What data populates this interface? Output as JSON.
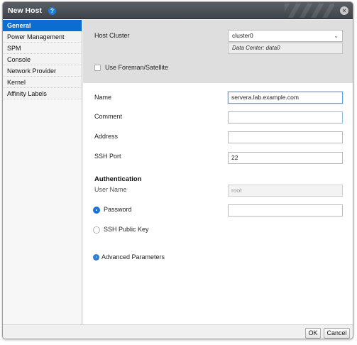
{
  "dialog": {
    "title": "New Host",
    "help_icon": "question-circle-icon",
    "close_icon": "close-icon"
  },
  "sidebar": {
    "items": [
      {
        "label": "General",
        "active": true
      },
      {
        "label": "Power Management",
        "active": false
      },
      {
        "label": "SPM",
        "active": false
      },
      {
        "label": "Console",
        "active": false
      },
      {
        "label": "Network Provider",
        "active": false
      },
      {
        "label": "Kernel",
        "active": false
      },
      {
        "label": "Affinity Labels",
        "active": false
      }
    ]
  },
  "general": {
    "host_cluster_label": "Host Cluster",
    "host_cluster_value": "cluster0",
    "data_center_text": "Data Center: data0",
    "use_foreman_label": "Use Foreman/Satellite",
    "name_label": "Name",
    "name_value": "servera.lab.example.com",
    "comment_label": "Comment",
    "comment_value": "",
    "address_label": "Address",
    "address_value": "",
    "ssh_port_label": "SSH Port",
    "ssh_port_value": "22",
    "authentication_title": "Authentication",
    "user_name_label": "User Name",
    "user_name_value": "root",
    "password_label": "Password",
    "password_value": "",
    "ssh_public_key_label": "SSH Public Key",
    "advanced_parameters_label": "Advanced Parameters"
  },
  "footer": {
    "ok_label": "OK",
    "cancel_label": "Cancel"
  },
  "colors": {
    "accent": "#0b6cd1",
    "titlebar": "#474c52"
  }
}
